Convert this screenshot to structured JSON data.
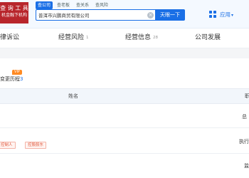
{
  "header": {
    "logo_line1": "查 询 工 具",
    "logo_line2": "机金融下机构",
    "tabs": [
      {
        "label": "查公司",
        "active": true
      },
      {
        "label": "查老板",
        "active": false
      },
      {
        "label": "查关系",
        "active": false
      },
      {
        "label": "查风险",
        "active": false
      }
    ],
    "search_value": "普洱市兴鹏商贸有限公司",
    "search_button": "天眼一下",
    "app_menu_label": "应用"
  },
  "nav": [
    {
      "label": "律诉讼",
      "count": ""
    },
    {
      "label": "经营风险",
      "count": "1"
    },
    {
      "label": "经营信息",
      "count": "28"
    },
    {
      "label": "公司发展",
      "count": ""
    }
  ],
  "section": {
    "vip_badge": "VIP",
    "title_prefix": "变更历程",
    "title_count": "3"
  },
  "table": {
    "header_name": "姓名",
    "header_right": "职",
    "rows": [
      {
        "right": "总",
        "tags": []
      },
      {
        "right": "执行",
        "tags": [
          "控制人",
          "控股股东"
        ]
      },
      {
        "right": "监",
        "tags": []
      }
    ]
  },
  "colors": {
    "brand_blue": "#1a6fe6",
    "logo_red": "#b8262c",
    "vip_orange": "#ff8a23",
    "tag_red": "#e0593e"
  }
}
